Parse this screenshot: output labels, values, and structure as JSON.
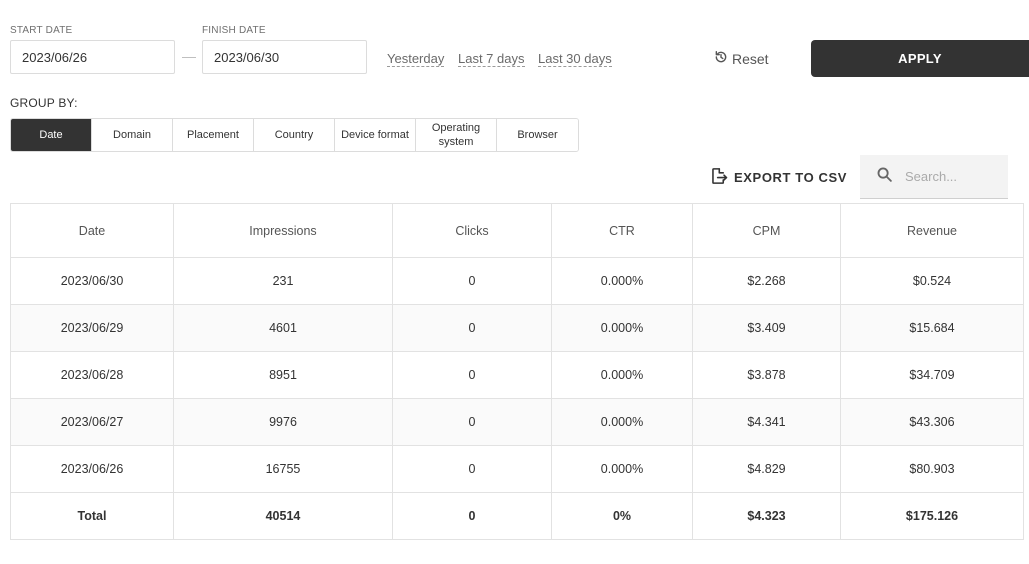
{
  "filters": {
    "start_label": "START DATE",
    "start_value": "2023/06/26",
    "finish_label": "FINISH DATE",
    "finish_value": "2023/06/30",
    "separator": "—",
    "quick_ranges": [
      "Yesterday",
      "Last 7 days",
      "Last 30 days"
    ],
    "reset_label": "Reset",
    "apply_label": "APPLY"
  },
  "group_by": {
    "label": "GROUP BY:",
    "options": [
      "Date",
      "Domain",
      "Placement",
      "Country",
      "Device format",
      "Operating system",
      "Browser"
    ],
    "active": "Date"
  },
  "toolbar": {
    "export_label": "EXPORT TO CSV",
    "search_placeholder": "Search..."
  },
  "table": {
    "columns": [
      "Date",
      "Impressions",
      "Clicks",
      "CTR",
      "CPM",
      "Revenue"
    ],
    "rows": [
      [
        "2023/06/30",
        "231",
        "0",
        "0.000%",
        "$2.268",
        "$0.524"
      ],
      [
        "2023/06/29",
        "4601",
        "0",
        "0.000%",
        "$3.409",
        "$15.684"
      ],
      [
        "2023/06/28",
        "8951",
        "0",
        "0.000%",
        "$3.878",
        "$34.709"
      ],
      [
        "2023/06/27",
        "9976",
        "0",
        "0.000%",
        "$4.341",
        "$43.306"
      ],
      [
        "2023/06/26",
        "16755",
        "0",
        "0.000%",
        "$4.829",
        "$80.903"
      ]
    ],
    "total": [
      "Total",
      "40514",
      "0",
      "0%",
      "$4.323",
      "$175.126"
    ]
  },
  "icons": {
    "reset": "reset-icon",
    "export": "export-icon",
    "search": "search-icon"
  },
  "colors": {
    "accent_dark": "#333333",
    "border": "#dcdcdc"
  }
}
